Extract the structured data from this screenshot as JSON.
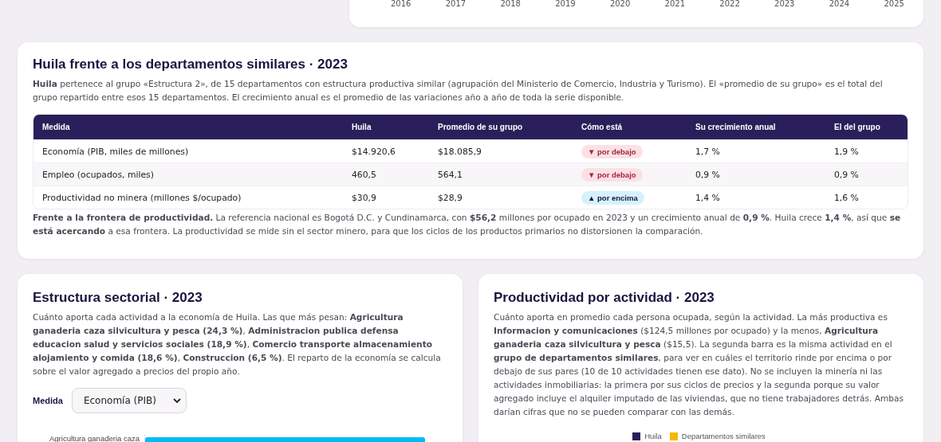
{
  "trend_card": {
    "x_labels": [
      "2016",
      "2017",
      "2018",
      "2019",
      "2020",
      "2021",
      "2022",
      "2023",
      "2024",
      "2025"
    ]
  },
  "comparison": {
    "title": "Huila frente a los departamentos similares · 2023",
    "intro": "**Huila** pertenece al grupo «Estructura 2», de 15 departamentos con estructura productiva similar (agrupación del Ministerio de Comercio, Industria y Turismo). El «promedio de su grupo» es el total del grupo repartido entre esos 15 departamentos. El crecimiento anual es el promedio de las variaciones año a año de toda la serie disponible.",
    "table": {
      "columns": [
        "Medida",
        "Huila",
        "Promedio de su grupo",
        "Cómo está",
        "Su crecimiento anual",
        "El del grupo"
      ],
      "rows": [
        {
          "measure": "Economía (PIB, miles de millones)",
          "huila": "$14.920,6",
          "group": "$18.085,9",
          "status": {
            "kind": "below",
            "label": "▼ por debajo"
          },
          "growth": "1,7 %",
          "group_growth": "1,9 %"
        },
        {
          "measure": "Empleo (ocupados, miles)",
          "huila": "460,5",
          "group": "564,1",
          "status": {
            "kind": "below",
            "label": "▼ por debajo"
          },
          "growth": "0,9 %",
          "group_growth": "0,9 %"
        },
        {
          "measure": "Productividad no minera (millones $/ocupado)",
          "huila": "$30,9",
          "group": "$28,9",
          "status": {
            "kind": "above",
            "label": "▲ por encima"
          },
          "growth": "1,4 %",
          "group_growth": "1,6 %"
        }
      ]
    },
    "note": "**Frente a la frontera de productividad.** La referencia nacional es Bogotá D.C. y Cundinamarca, con **$56,2** millones por ocupado en 2023 y un crecimiento anual de **0,9 %**. Huila crece **1,4 %**, así que **se está acercando** a esa frontera. La productividad se mide sin el sector minero, para que los ciclos de los productos primarios no distorsionen la comparación."
  },
  "sector_structure": {
    "title": "Estructura sectorial · 2023",
    "text": "Cuánto aporta cada actividad a la economía de Huila. Las que más pesan: **Agricultura ganaderia caza silvicultura y pesca (24,3 %)**, **Administracion publica defensa educacion salud y servicios sociales (18,9 %)**, **Comercio transporte almacenamiento alojamiento y comida (18,6 %)**, **Construccion (6,5 %)**. El reparto de la economía se calcula sobre el valor agregado a precios del propio año.",
    "measure_label": "Medida",
    "measure_value": "Economía (PIB)",
    "bar_label": "Agricultura ganaderia caza"
  },
  "productivity": {
    "title": "Productividad por actividad · 2023",
    "text": "Cuánto aporta en promedio cada persona ocupada, según la actividad. La más productiva es **Informacion y comunicaciones** ($124,5 millones por ocupado) y la menos, **Agricultura ganaderia caza silvicultura y pesca** ($15,5). La segunda barra es la misma actividad en el **grupo de departamentos similares**, para ver en cuáles el territorio rinde por encima o por debajo de sus pares (10 de 10 actividades tienen ese dato). No se incluyen la minería ni las actividades inmobiliarias: la primera por sus ciclos de precios y la segunda porque su valor agregado incluye el alquiler imputado de las viviendas, que no tiene trabajadores detrás. Ambas darían cifras que no se pueden comparar con las demás.",
    "legend": [
      {
        "label": "Huila",
        "color": "#2a1f5a"
      },
      {
        "label": "Departamentos similares",
        "color": "#f5b800"
      }
    ]
  }
}
